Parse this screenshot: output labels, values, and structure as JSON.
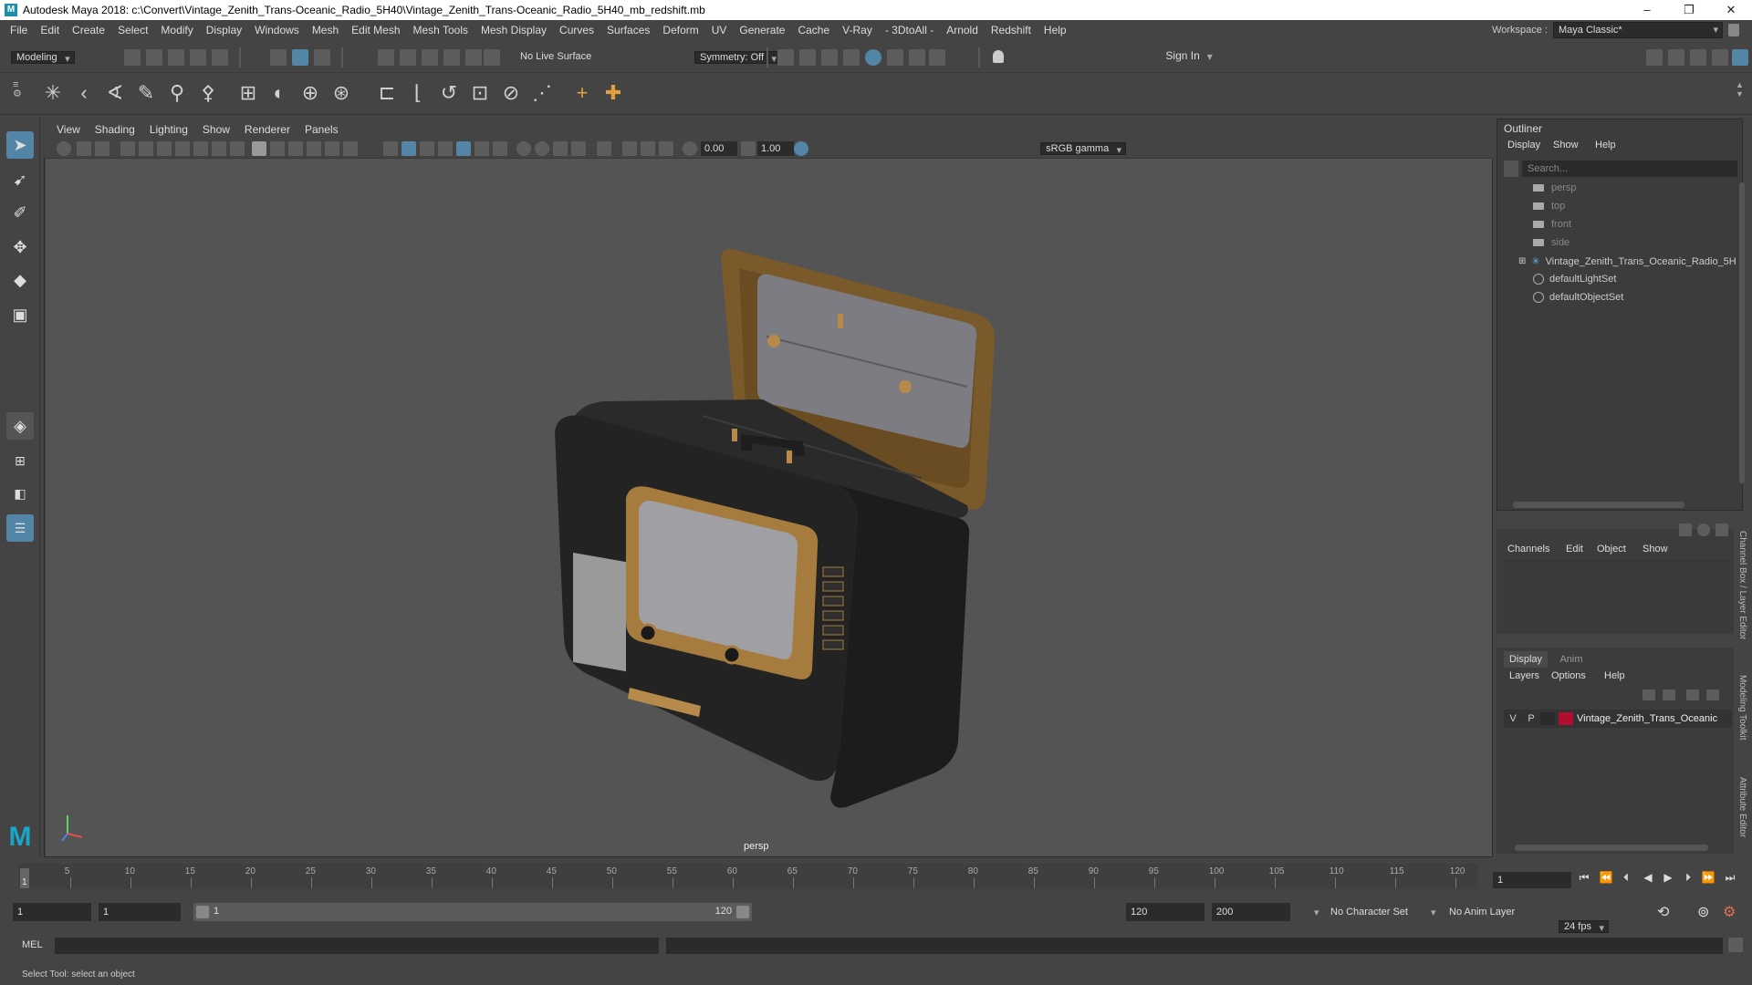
{
  "title": "Autodesk Maya 2018: c:\\Convert\\Vintage_Zenith_Trans-Oceanic_Radio_5H40\\Vintage_Zenith_Trans-Oceanic_Radio_5H40_mb_redshift.mb",
  "window_controls": {
    "minimize": "–",
    "maximize": "❐",
    "close": "✕"
  },
  "menu": [
    "File",
    "Edit",
    "Create",
    "Select",
    "Modify",
    "Display",
    "Windows",
    "Mesh",
    "Edit Mesh",
    "Mesh Tools",
    "Mesh Display",
    "Curves",
    "Surfaces",
    "Deform",
    "UV",
    "Generate",
    "Cache",
    "V-Ray",
    "- 3DtoAll -",
    "Arnold",
    "Redshift",
    "Help"
  ],
  "workspace": {
    "label": "Workspace :",
    "value": "Maya Classic*"
  },
  "statusline": {
    "mode": "Modeling",
    "live_surface": "No Live Surface",
    "symmetry": "Symmetry: Off",
    "sign_in": "Sign In"
  },
  "viewport": {
    "menu": [
      "View",
      "Shading",
      "Lighting",
      "Show",
      "Renderer",
      "Panels"
    ],
    "exposure": "0.00",
    "gamma": "1.00",
    "colorspace": "sRGB gamma",
    "camera_label": "persp"
  },
  "outliner": {
    "title": "Outliner",
    "menu": [
      "Display",
      "Show",
      "Help"
    ],
    "search_placeholder": "Search...",
    "items": [
      {
        "label": "persp",
        "kind": "camera"
      },
      {
        "label": "top",
        "kind": "camera"
      },
      {
        "label": "front",
        "kind": "camera"
      },
      {
        "label": "side",
        "kind": "camera"
      },
      {
        "label": "Vintage_Zenith_Trans_Oceanic_Radio_5H",
        "kind": "group"
      },
      {
        "label": "defaultLightSet",
        "kind": "set"
      },
      {
        "label": "defaultObjectSet",
        "kind": "set"
      }
    ]
  },
  "channel_box": {
    "menu": [
      "Channels",
      "Edit",
      "Object",
      "Show"
    ]
  },
  "layer_editor": {
    "tabs": [
      "Display",
      "Anim"
    ],
    "menu": [
      "Layers",
      "Options",
      "Help"
    ],
    "layer": {
      "v": "V",
      "p": "P",
      "name": "Vintage_Zenith_Trans_Oceanic",
      "color": "#b01030"
    }
  },
  "side_tabs": [
    "Channel Box / Layer Editor",
    "Modeling Toolkit",
    "Attribute Editor"
  ],
  "timeline": {
    "ticks": [
      "5",
      "10",
      "15",
      "20",
      "25",
      "30",
      "35",
      "40",
      "45",
      "50",
      "55",
      "60",
      "65",
      "70",
      "75",
      "80",
      "85",
      "90",
      "95",
      "100",
      "105",
      "110",
      "115",
      "120"
    ],
    "current_frame_label": "1",
    "current_frame_field": "1"
  },
  "range": {
    "start": "1",
    "playback_start": "1",
    "slider_start": "1",
    "slider_end": "120",
    "playback_end": "120",
    "end": "200",
    "character_set": "No Character Set",
    "anim_layer": "No Anim Layer",
    "fps": "24 fps"
  },
  "command_line": {
    "label": "MEL"
  },
  "help_line": "Select Tool: select an object"
}
